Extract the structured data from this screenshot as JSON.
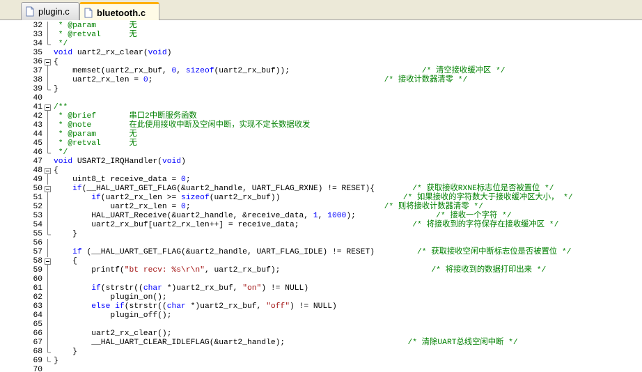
{
  "tabs": [
    {
      "label": "plugin.c",
      "active": false
    },
    {
      "label": "bluetooth.c",
      "active": true
    }
  ],
  "colors": {
    "comment": "#008000",
    "keyword": "#0000ff",
    "string": "#a31515",
    "number": "#0000ff",
    "tab_accent": "#ffb000"
  },
  "lines": [
    {
      "n": "32",
      "fold": "bar",
      "t": [
        [
          "c",
          " * @param       无"
        ]
      ]
    },
    {
      "n": "33",
      "fold": "bar",
      "t": [
        [
          "c",
          " * @retval      无"
        ]
      ]
    },
    {
      "n": "34",
      "fold": "end",
      "t": [
        [
          "c",
          " */"
        ]
      ]
    },
    {
      "n": "35",
      "fold": "none",
      "t": [
        [
          "k",
          "void"
        ],
        [
          "p",
          " uart2_rx_clear("
        ],
        [
          "k",
          "void"
        ],
        [
          "p",
          ")"
        ]
      ]
    },
    {
      "n": "36",
      "fold": "open",
      "t": [
        [
          "p",
          "{"
        ]
      ]
    },
    {
      "n": "37",
      "fold": "bar",
      "t": [
        [
          "p",
          "    memset(uart2_rx_buf, "
        ],
        [
          "n",
          "0"
        ],
        [
          "p",
          ", "
        ],
        [
          "k",
          "sizeof"
        ],
        [
          "p",
          "(uart2_rx_buf));                            "
        ],
        [
          "c",
          "/* 清空接收缓冲区 */"
        ]
      ]
    },
    {
      "n": "38",
      "fold": "bar",
      "t": [
        [
          "p",
          "    uart2_rx_len = "
        ],
        [
          "n",
          "0"
        ],
        [
          "p",
          ";                                                 "
        ],
        [
          "c",
          "/* 接收计数器清零 */"
        ]
      ]
    },
    {
      "n": "39",
      "fold": "end",
      "t": [
        [
          "p",
          "}"
        ]
      ]
    },
    {
      "n": "40",
      "fold": "none",
      "t": []
    },
    {
      "n": "41",
      "fold": "open",
      "t": [
        [
          "c",
          "/**"
        ]
      ]
    },
    {
      "n": "42",
      "fold": "bar",
      "t": [
        [
          "c",
          " * @brief       串口2中断服务函数"
        ]
      ]
    },
    {
      "n": "43",
      "fold": "bar",
      "t": [
        [
          "c",
          " * @note        在此使用接收中断及空闲中断，实现不定长数据收发"
        ]
      ]
    },
    {
      "n": "44",
      "fold": "bar",
      "t": [
        [
          "c",
          " * @param       无"
        ]
      ]
    },
    {
      "n": "45",
      "fold": "bar",
      "t": [
        [
          "c",
          " * @retval      无"
        ]
      ]
    },
    {
      "n": "46",
      "fold": "end",
      "t": [
        [
          "c",
          " */"
        ]
      ]
    },
    {
      "n": "47",
      "fold": "none",
      "t": [
        [
          "k",
          "void"
        ],
        [
          "p",
          " USART2_IRQHandler("
        ],
        [
          "k",
          "void"
        ],
        [
          "p",
          ")"
        ]
      ]
    },
    {
      "n": "48",
      "fold": "open",
      "t": [
        [
          "p",
          "{"
        ]
      ]
    },
    {
      "n": "49",
      "fold": "bar",
      "t": [
        [
          "p",
          "    uint8_t receive_data = "
        ],
        [
          "n",
          "0"
        ],
        [
          "p",
          ";"
        ]
      ]
    },
    {
      "n": "50",
      "fold": "open",
      "t": [
        [
          "p",
          "    "
        ],
        [
          "k",
          "if"
        ],
        [
          "p",
          "(__HAL_UART_GET_FLAG(&uart2_handle, UART_FLAG_RXNE) != RESET){        "
        ],
        [
          "c",
          "/* 获取接收RXNE标志位是否被置位 */"
        ]
      ]
    },
    {
      "n": "51",
      "fold": "bar",
      "t": [
        [
          "p",
          "        "
        ],
        [
          "k",
          "if"
        ],
        [
          "p",
          "(uart2_rx_len >= "
        ],
        [
          "k",
          "sizeof"
        ],
        [
          "p",
          "(uart2_rx_buf))                          "
        ],
        [
          "c",
          "/* 如果接收的字符数大于接收缓冲区大小， */"
        ]
      ]
    },
    {
      "n": "52",
      "fold": "bar",
      "t": [
        [
          "p",
          "            uart2_rx_len = "
        ],
        [
          "n",
          "0"
        ],
        [
          "p",
          ";                                         "
        ],
        [
          "c",
          "/* 则将接收计数器清零 */"
        ]
      ]
    },
    {
      "n": "53",
      "fold": "bar",
      "t": [
        [
          "p",
          "        HAL_UART_Receive(&uart2_handle, &receive_data, "
        ],
        [
          "n",
          "1"
        ],
        [
          "p",
          ", "
        ],
        [
          "n",
          "1000"
        ],
        [
          "p",
          ");                 "
        ],
        [
          "c",
          "/* 接收一个字符 */"
        ]
      ]
    },
    {
      "n": "54",
      "fold": "bar",
      "t": [
        [
          "p",
          "        uart2_rx_buf[uart2_rx_len++] = receive_data;                        "
        ],
        [
          "c",
          "/* 将接收到的字符保存在接收缓冲区 */"
        ]
      ]
    },
    {
      "n": "55",
      "fold": "end",
      "t": [
        [
          "p",
          "    }"
        ]
      ]
    },
    {
      "n": "56",
      "fold": "bar",
      "t": []
    },
    {
      "n": "57",
      "fold": "bar",
      "t": [
        [
          "p",
          "    "
        ],
        [
          "k",
          "if"
        ],
        [
          "p",
          " (__HAL_UART_GET_FLAG(&uart2_handle, UART_FLAG_IDLE) != RESET)         "
        ],
        [
          "c",
          "/* 获取接收空闲中断标志位是否被置位 */"
        ]
      ]
    },
    {
      "n": "58",
      "fold": "open",
      "t": [
        [
          "p",
          "    {"
        ]
      ]
    },
    {
      "n": "59",
      "fold": "bar",
      "t": [
        [
          "p",
          "        printf("
        ],
        [
          "s",
          "\"bt recv: %s\\r\\n\""
        ],
        [
          "p",
          ", uart2_rx_buf);                                "
        ],
        [
          "c",
          "/* 将接收到的数据打印出来 */"
        ]
      ]
    },
    {
      "n": "60",
      "fold": "bar",
      "t": []
    },
    {
      "n": "61",
      "fold": "bar",
      "t": [
        [
          "p",
          "        "
        ],
        [
          "k",
          "if"
        ],
        [
          "p",
          "(strstr(("
        ],
        [
          "k",
          "char"
        ],
        [
          "p",
          " *)uart2_rx_buf, "
        ],
        [
          "s",
          "\"on\""
        ],
        [
          "p",
          ") != NULL)"
        ]
      ]
    },
    {
      "n": "62",
      "fold": "bar",
      "t": [
        [
          "p",
          "            plugin_on();"
        ]
      ]
    },
    {
      "n": "63",
      "fold": "bar",
      "t": [
        [
          "p",
          "        "
        ],
        [
          "k",
          "else"
        ],
        [
          "p",
          " "
        ],
        [
          "k",
          "if"
        ],
        [
          "p",
          "(strstr(("
        ],
        [
          "k",
          "char"
        ],
        [
          "p",
          " *)uart2_rx_buf, "
        ],
        [
          "s",
          "\"off\""
        ],
        [
          "p",
          ") != NULL)"
        ]
      ]
    },
    {
      "n": "64",
      "fold": "bar",
      "t": [
        [
          "p",
          "            plugin_off();"
        ]
      ]
    },
    {
      "n": "65",
      "fold": "bar",
      "t": []
    },
    {
      "n": "66",
      "fold": "bar",
      "t": [
        [
          "p",
          "        uart2_rx_clear();"
        ]
      ]
    },
    {
      "n": "67",
      "fold": "bar",
      "t": [
        [
          "p",
          "        __HAL_UART_CLEAR_IDLEFLAG(&uart2_handle);                          "
        ],
        [
          "c",
          "/* 清除UART总线空闲中断 */"
        ]
      ]
    },
    {
      "n": "68",
      "fold": "end",
      "t": [
        [
          "p",
          "    }"
        ]
      ]
    },
    {
      "n": "69",
      "fold": "end",
      "t": [
        [
          "p",
          "}"
        ]
      ]
    },
    {
      "n": "70",
      "fold": "none",
      "t": []
    }
  ]
}
